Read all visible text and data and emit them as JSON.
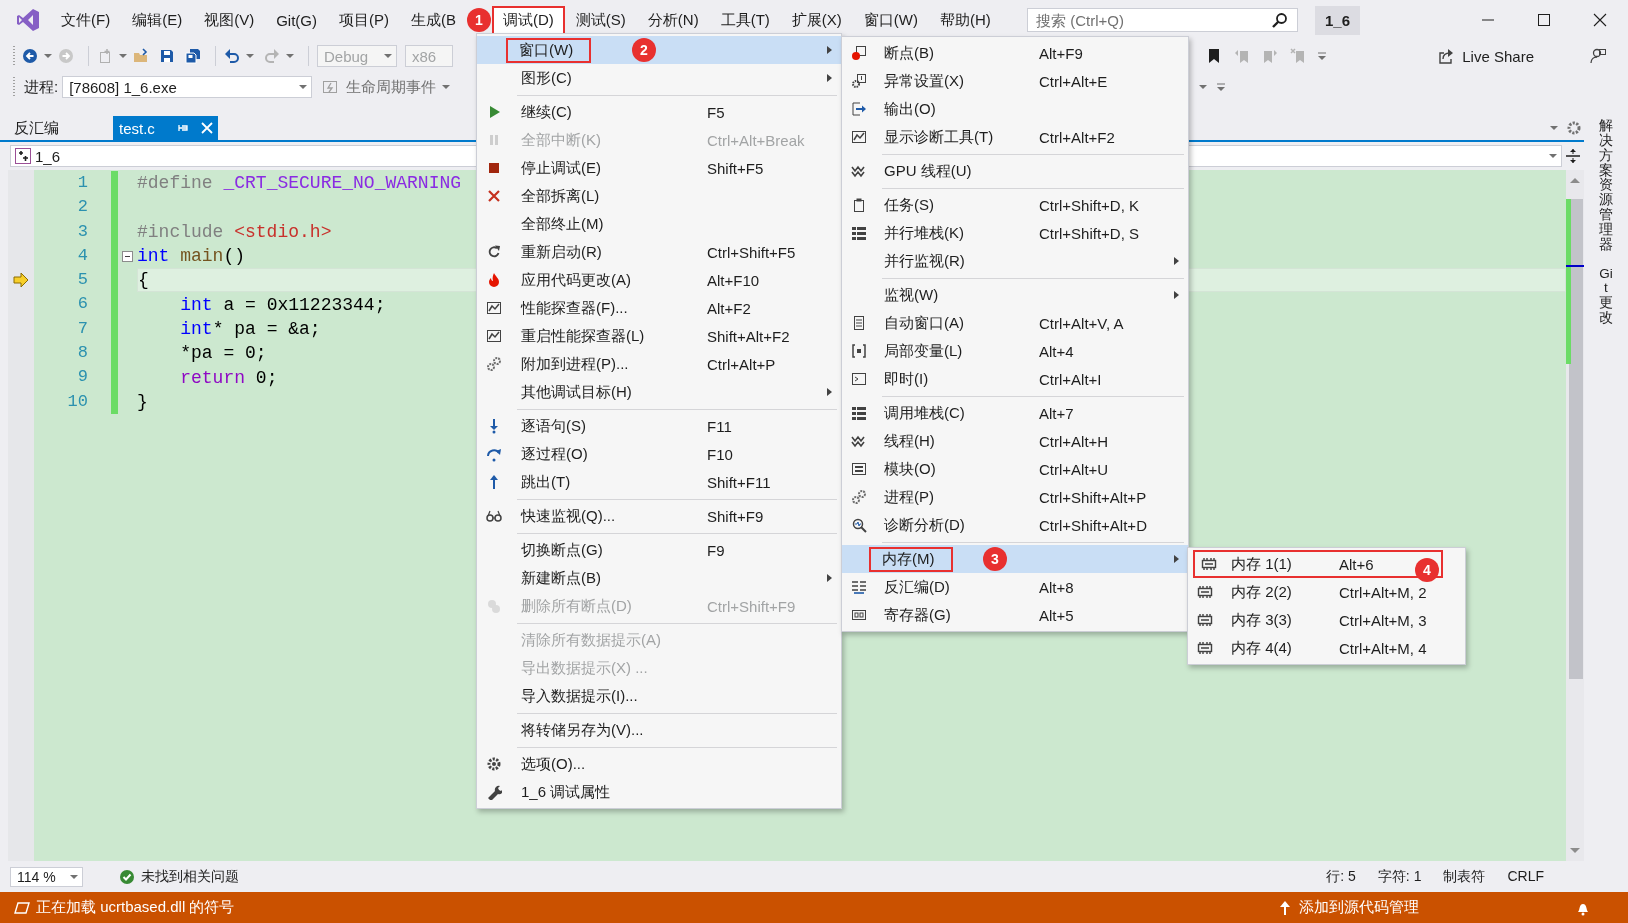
{
  "title_bar": {
    "menus": [
      {
        "label": "文件(F)",
        "selected": false,
        "red_box": false
      },
      {
        "label": "编辑(E)",
        "selected": false,
        "red_box": false
      },
      {
        "label": "视图(V)",
        "selected": false,
        "red_box": false
      },
      {
        "label": "Git(G)",
        "selected": false,
        "red_box": false
      },
      {
        "label": "项目(P)",
        "selected": false,
        "red_box": false
      },
      {
        "label": "生成(B",
        "selected": false,
        "red_box": false
      },
      {
        "label": "调试(D)",
        "selected": true,
        "red_box": true,
        "callout": "1"
      },
      {
        "label": "测试(S)",
        "selected": false,
        "red_box": false
      },
      {
        "label": "分析(N)",
        "selected": false,
        "red_box": false
      },
      {
        "label": "工具(T)",
        "selected": false,
        "red_box": false
      },
      {
        "label": "扩展(X)",
        "selected": false,
        "red_box": false
      },
      {
        "label": "窗口(W)",
        "selected": false,
        "red_box": false
      },
      {
        "label": "帮助(H)",
        "selected": false,
        "red_box": false
      }
    ],
    "search": {
      "placeholder": "搜索 (Ctrl+Q)"
    },
    "solution_name": "1_6"
  },
  "toolbar": {
    "configuration": {
      "value": "Debug",
      "disabled": true
    },
    "platform": {
      "value": "x86",
      "disabled": true
    },
    "live_share": "Live Share"
  },
  "debug_location": {
    "label": "进程:",
    "process": "[78608] 1_6.exe",
    "lifecycle": "生命周期事件"
  },
  "doc_tabs": [
    {
      "label": "反汇编",
      "selected": false
    },
    {
      "label": "test.c",
      "selected": true
    }
  ],
  "nav_bar": {
    "scope": "1_6"
  },
  "editor": {
    "lines": [
      {
        "number": "1",
        "current": false,
        "fold": false,
        "changed": true,
        "tokens": [
          {
            "text": "#define ",
            "kind": "preproc"
          },
          {
            "text": "_CRT_SECURE_NO_WARNING",
            "kind": "macro"
          }
        ]
      },
      {
        "number": "2",
        "current": false,
        "fold": false,
        "changed": true
      },
      {
        "number": "3",
        "current": false,
        "fold": false,
        "changed": true,
        "tokens": [
          {
            "text": "#include ",
            "kind": "preproc"
          },
          {
            "text": "<stdio.h>",
            "kind": "string"
          }
        ]
      },
      {
        "number": "4",
        "current": false,
        "fold": true,
        "changed": true,
        "tokens": [
          {
            "text": "int ",
            "kind": "keyword"
          },
          {
            "text": "main",
            "kind": "function"
          },
          {
            "text": "()",
            "kind": "plain"
          }
        ]
      },
      {
        "number": "5",
        "current": true,
        "fold": false,
        "changed": true,
        "tokens": [
          {
            "text": "{",
            "kind": "plain"
          }
        ]
      },
      {
        "number": "6",
        "current": false,
        "fold": false,
        "changed": true,
        "tokens": [
          {
            "text": "    int",
            "kind": "keyword"
          },
          {
            "text": " a = 0x11223344;",
            "kind": "plain"
          }
        ]
      },
      {
        "number": "7",
        "current": false,
        "fold": false,
        "changed": true,
        "tokens": [
          {
            "text": "    int",
            "kind": "keyword"
          },
          {
            "text": "* pa = &a;",
            "kind": "plain"
          }
        ]
      },
      {
        "number": "8",
        "current": false,
        "fold": false,
        "changed": true,
        "tokens": [
          {
            "text": "    *pa = 0;",
            "kind": "plain"
          }
        ]
      },
      {
        "number": "9",
        "current": false,
        "fold": false,
        "changed": true,
        "tokens": [
          {
            "text": "    return",
            "kind": "control"
          },
          {
            "text": " 0;",
            "kind": "plain"
          }
        ]
      },
      {
        "number": "10",
        "current": false,
        "fold": false,
        "changed": true,
        "tokens": [
          {
            "text": "}",
            "kind": "plain"
          }
        ]
      }
    ]
  },
  "side_tabs": [
    "解决方案资源管理器",
    "Git 更改"
  ],
  "editor_status": {
    "zoom": "114 %",
    "issues": "未找到相关问题",
    "line": "行: 5",
    "column": "字符: 1",
    "indent": "制表符",
    "line_ending": "CRLF"
  },
  "status_bar": {
    "message": "正在加载 ucrtbased.dll 的符号",
    "source_control": "添加到源代码管理"
  },
  "debug_menu": {
    "items": [
      {
        "kind": "item",
        "label": "窗口(W)",
        "submenu": true,
        "disabled": false,
        "selected": true,
        "red_box": true,
        "callout": "2"
      },
      {
        "kind": "item",
        "label": "图形(C)",
        "submenu": true,
        "disabled": false,
        "selected": false,
        "red_box": false
      },
      {
        "kind": "separator"
      },
      {
        "kind": "item",
        "label": "继续(C)",
        "shortcut": "F5",
        "submenu": false,
        "disabled": false,
        "selected": false,
        "red_box": false
      },
      {
        "kind": "item",
        "label": "全部中断(K)",
        "shortcut": "Ctrl+Alt+Break",
        "submenu": false,
        "disabled": true,
        "selected": false,
        "red_box": false
      },
      {
        "kind": "item",
        "label": "停止调试(E)",
        "shortcut": "Shift+F5",
        "submenu": false,
        "disabled": false,
        "selected": false,
        "red_box": false
      },
      {
        "kind": "item",
        "label": "全部拆离(L)",
        "submenu": false,
        "disabled": false,
        "selected": false,
        "red_box": false
      },
      {
        "kind": "item",
        "label": "全部终止(M)",
        "submenu": false,
        "disabled": false,
        "selected": false,
        "red_box": false
      },
      {
        "kind": "item",
        "label": "重新启动(R)",
        "shortcut": "Ctrl+Shift+F5",
        "submenu": false,
        "disabled": false,
        "selected": false,
        "red_box": false
      },
      {
        "kind": "item",
        "label": "应用代码更改(A)",
        "shortcut": "Alt+F10",
        "submenu": false,
        "disabled": false,
        "selected": false,
        "red_box": false
      },
      {
        "kind": "item",
        "label": "性能探查器(F)...",
        "shortcut": "Alt+F2",
        "submenu": false,
        "disabled": false,
        "selected": false,
        "red_box": false
      },
      {
        "kind": "item",
        "label": "重启性能探查器(L)",
        "shortcut": "Shift+Alt+F2",
        "submenu": false,
        "disabled": false,
        "selected": false,
        "red_box": false
      },
      {
        "kind": "item",
        "label": "附加到进程(P)...",
        "shortcut": "Ctrl+Alt+P",
        "submenu": false,
        "disabled": false,
        "selected": false,
        "red_box": false
      },
      {
        "kind": "item",
        "label": "其他调试目标(H)",
        "submenu": true,
        "disabled": false,
        "selected": false,
        "red_box": false
      },
      {
        "kind": "separator"
      },
      {
        "kind": "item",
        "label": "逐语句(S)",
        "shortcut": "F11",
        "submenu": false,
        "disabled": false,
        "selected": false,
        "red_box": false
      },
      {
        "kind": "item",
        "label": "逐过程(O)",
        "shortcut": "F10",
        "submenu": false,
        "disabled": false,
        "selected": false,
        "red_box": false
      },
      {
        "kind": "item",
        "label": "跳出(T)",
        "shortcut": "Shift+F11",
        "submenu": false,
        "disabled": false,
        "selected": false,
        "red_box": false
      },
      {
        "kind": "separator"
      },
      {
        "kind": "item",
        "label": "快速监视(Q)...",
        "shortcut": "Shift+F9",
        "submenu": false,
        "disabled": false,
        "selected": false,
        "red_box": false
      },
      {
        "kind": "separator"
      },
      {
        "kind": "item",
        "label": "切换断点(G)",
        "shortcut": "F9",
        "submenu": false,
        "disabled": false,
        "selected": false,
        "red_box": false
      },
      {
        "kind": "item",
        "label": "新建断点(B)",
        "submenu": true,
        "disabled": false,
        "selected": false,
        "red_box": false
      },
      {
        "kind": "item",
        "label": "删除所有断点(D)",
        "shortcut": "Ctrl+Shift+F9",
        "submenu": false,
        "disabled": true,
        "selected": false,
        "red_box": false
      },
      {
        "kind": "separator"
      },
      {
        "kind": "item",
        "label": "清除所有数据提示(A)",
        "submenu": false,
        "disabled": true,
        "selected": false,
        "red_box": false
      },
      {
        "kind": "item",
        "label": "导出数据提示(X) ...",
        "submenu": false,
        "disabled": true,
        "selected": false,
        "red_box": false
      },
      {
        "kind": "item",
        "label": "导入数据提示(I)...",
        "submenu": false,
        "disabled": false,
        "selected": false,
        "red_box": false
      },
      {
        "kind": "separator"
      },
      {
        "kind": "item",
        "label": "将转储另存为(V)...",
        "submenu": false,
        "disabled": false,
        "selected": false,
        "red_box": false
      },
      {
        "kind": "separator"
      },
      {
        "kind": "item",
        "label": "选项(O)...",
        "submenu": false,
        "disabled": false,
        "selected": false,
        "red_box": false
      },
      {
        "kind": "item",
        "label": "1_6 调试属性",
        "submenu": false,
        "disabled": false,
        "selected": false,
        "red_box": false
      }
    ]
  },
  "window_submenu": {
    "items": [
      {
        "kind": "item",
        "label": "断点(B)",
        "shortcut": "Alt+F9",
        "submenu": false,
        "disabled": false,
        "selected": false,
        "red_box": false
      },
      {
        "kind": "item",
        "label": "异常设置(X)",
        "shortcut": "Ctrl+Alt+E",
        "submenu": false,
        "disabled": false,
        "selected": false,
        "red_box": false
      },
      {
        "kind": "item",
        "label": "输出(O)",
        "submenu": false,
        "disabled": false,
        "selected": false,
        "red_box": false
      },
      {
        "kind": "item",
        "label": "显示诊断工具(T)",
        "shortcut": "Ctrl+Alt+F2",
        "submenu": false,
        "disabled": false,
        "selected": false,
        "red_box": false
      },
      {
        "kind": "separator"
      },
      {
        "kind": "item",
        "label": "GPU 线程(U)",
        "submenu": false,
        "disabled": false,
        "selected": false,
        "red_box": false
      },
      {
        "kind": "separator"
      },
      {
        "kind": "item",
        "label": "任务(S)",
        "shortcut": "Ctrl+Shift+D, K",
        "submenu": false,
        "disabled": false,
        "selected": false,
        "red_box": false
      },
      {
        "kind": "item",
        "label": "并行堆栈(K)",
        "shortcut": "Ctrl+Shift+D, S",
        "submenu": false,
        "disabled": false,
        "selected": false,
        "red_box": false
      },
      {
        "kind": "item",
        "label": "并行监视(R)",
        "submenu": true,
        "disabled": false,
        "selected": false,
        "red_box": false
      },
      {
        "kind": "separator"
      },
      {
        "kind": "item",
        "label": "监视(W)",
        "submenu": true,
        "disabled": false,
        "selected": false,
        "red_box": false
      },
      {
        "kind": "item",
        "label": "自动窗口(A)",
        "shortcut": "Ctrl+Alt+V, A",
        "submenu": false,
        "disabled": false,
        "selected": false,
        "red_box": false
      },
      {
        "kind": "item",
        "label": "局部变量(L)",
        "shortcut": "Alt+4",
        "submenu": false,
        "disabled": false,
        "selected": false,
        "red_box": false
      },
      {
        "kind": "item",
        "label": "即时(I)",
        "shortcut": "Ctrl+Alt+I",
        "submenu": false,
        "disabled": false,
        "selected": false,
        "red_box": false
      },
      {
        "kind": "separator"
      },
      {
        "kind": "item",
        "label": "调用堆栈(C)",
        "shortcut": "Alt+7",
        "submenu": false,
        "disabled": false,
        "selected": false,
        "red_box": false
      },
      {
        "kind": "item",
        "label": "线程(H)",
        "shortcut": "Ctrl+Alt+H",
        "submenu": false,
        "disabled": false,
        "selected": false,
        "red_box": false
      },
      {
        "kind": "item",
        "label": "模块(O)",
        "shortcut": "Ctrl+Alt+U",
        "submenu": false,
        "disabled": false,
        "selected": false,
        "red_box": false
      },
      {
        "kind": "item",
        "label": "进程(P)",
        "shortcut": "Ctrl+Shift+Alt+P",
        "submenu": false,
        "disabled": false,
        "selected": false,
        "red_box": false
      },
      {
        "kind": "item",
        "label": "诊断分析(D)",
        "shortcut": "Ctrl+Shift+Alt+D",
        "submenu": false,
        "disabled": false,
        "selected": false,
        "red_box": false
      },
      {
        "kind": "separator"
      },
      {
        "kind": "item",
        "label": "内存(M)",
        "submenu": true,
        "disabled": false,
        "selected": true,
        "red_box": true,
        "callout": "3"
      },
      {
        "kind": "item",
        "label": "反汇编(D)",
        "shortcut": "Alt+8",
        "submenu": false,
        "disabled": false,
        "selected": false,
        "red_box": false
      },
      {
        "kind": "item",
        "label": "寄存器(G)",
        "shortcut": "Alt+5",
        "submenu": false,
        "disabled": false,
        "selected": false,
        "red_box": false
      }
    ]
  },
  "memory_submenu": {
    "items": [
      {
        "kind": "item",
        "label": "内存 1(1)",
        "shortcut": "Alt+6",
        "submenu": false,
        "disabled": false,
        "selected": false,
        "red_box": true,
        "callout": "4"
      },
      {
        "kind": "item",
        "label": "内存 2(2)",
        "shortcut": "Ctrl+Alt+M, 2",
        "submenu": false,
        "disabled": false,
        "selected": false,
        "red_box": false
      },
      {
        "kind": "item",
        "label": "内存 3(3)",
        "shortcut": "Ctrl+Alt+M, 3",
        "submenu": false,
        "disabled": false,
        "selected": false,
        "red_box": false
      },
      {
        "kind": "item",
        "label": "内存 4(4)",
        "shortcut": "Ctrl+Alt+M, 4",
        "submenu": false,
        "disabled": false,
        "selected": false,
        "red_box": false
      }
    ]
  }
}
